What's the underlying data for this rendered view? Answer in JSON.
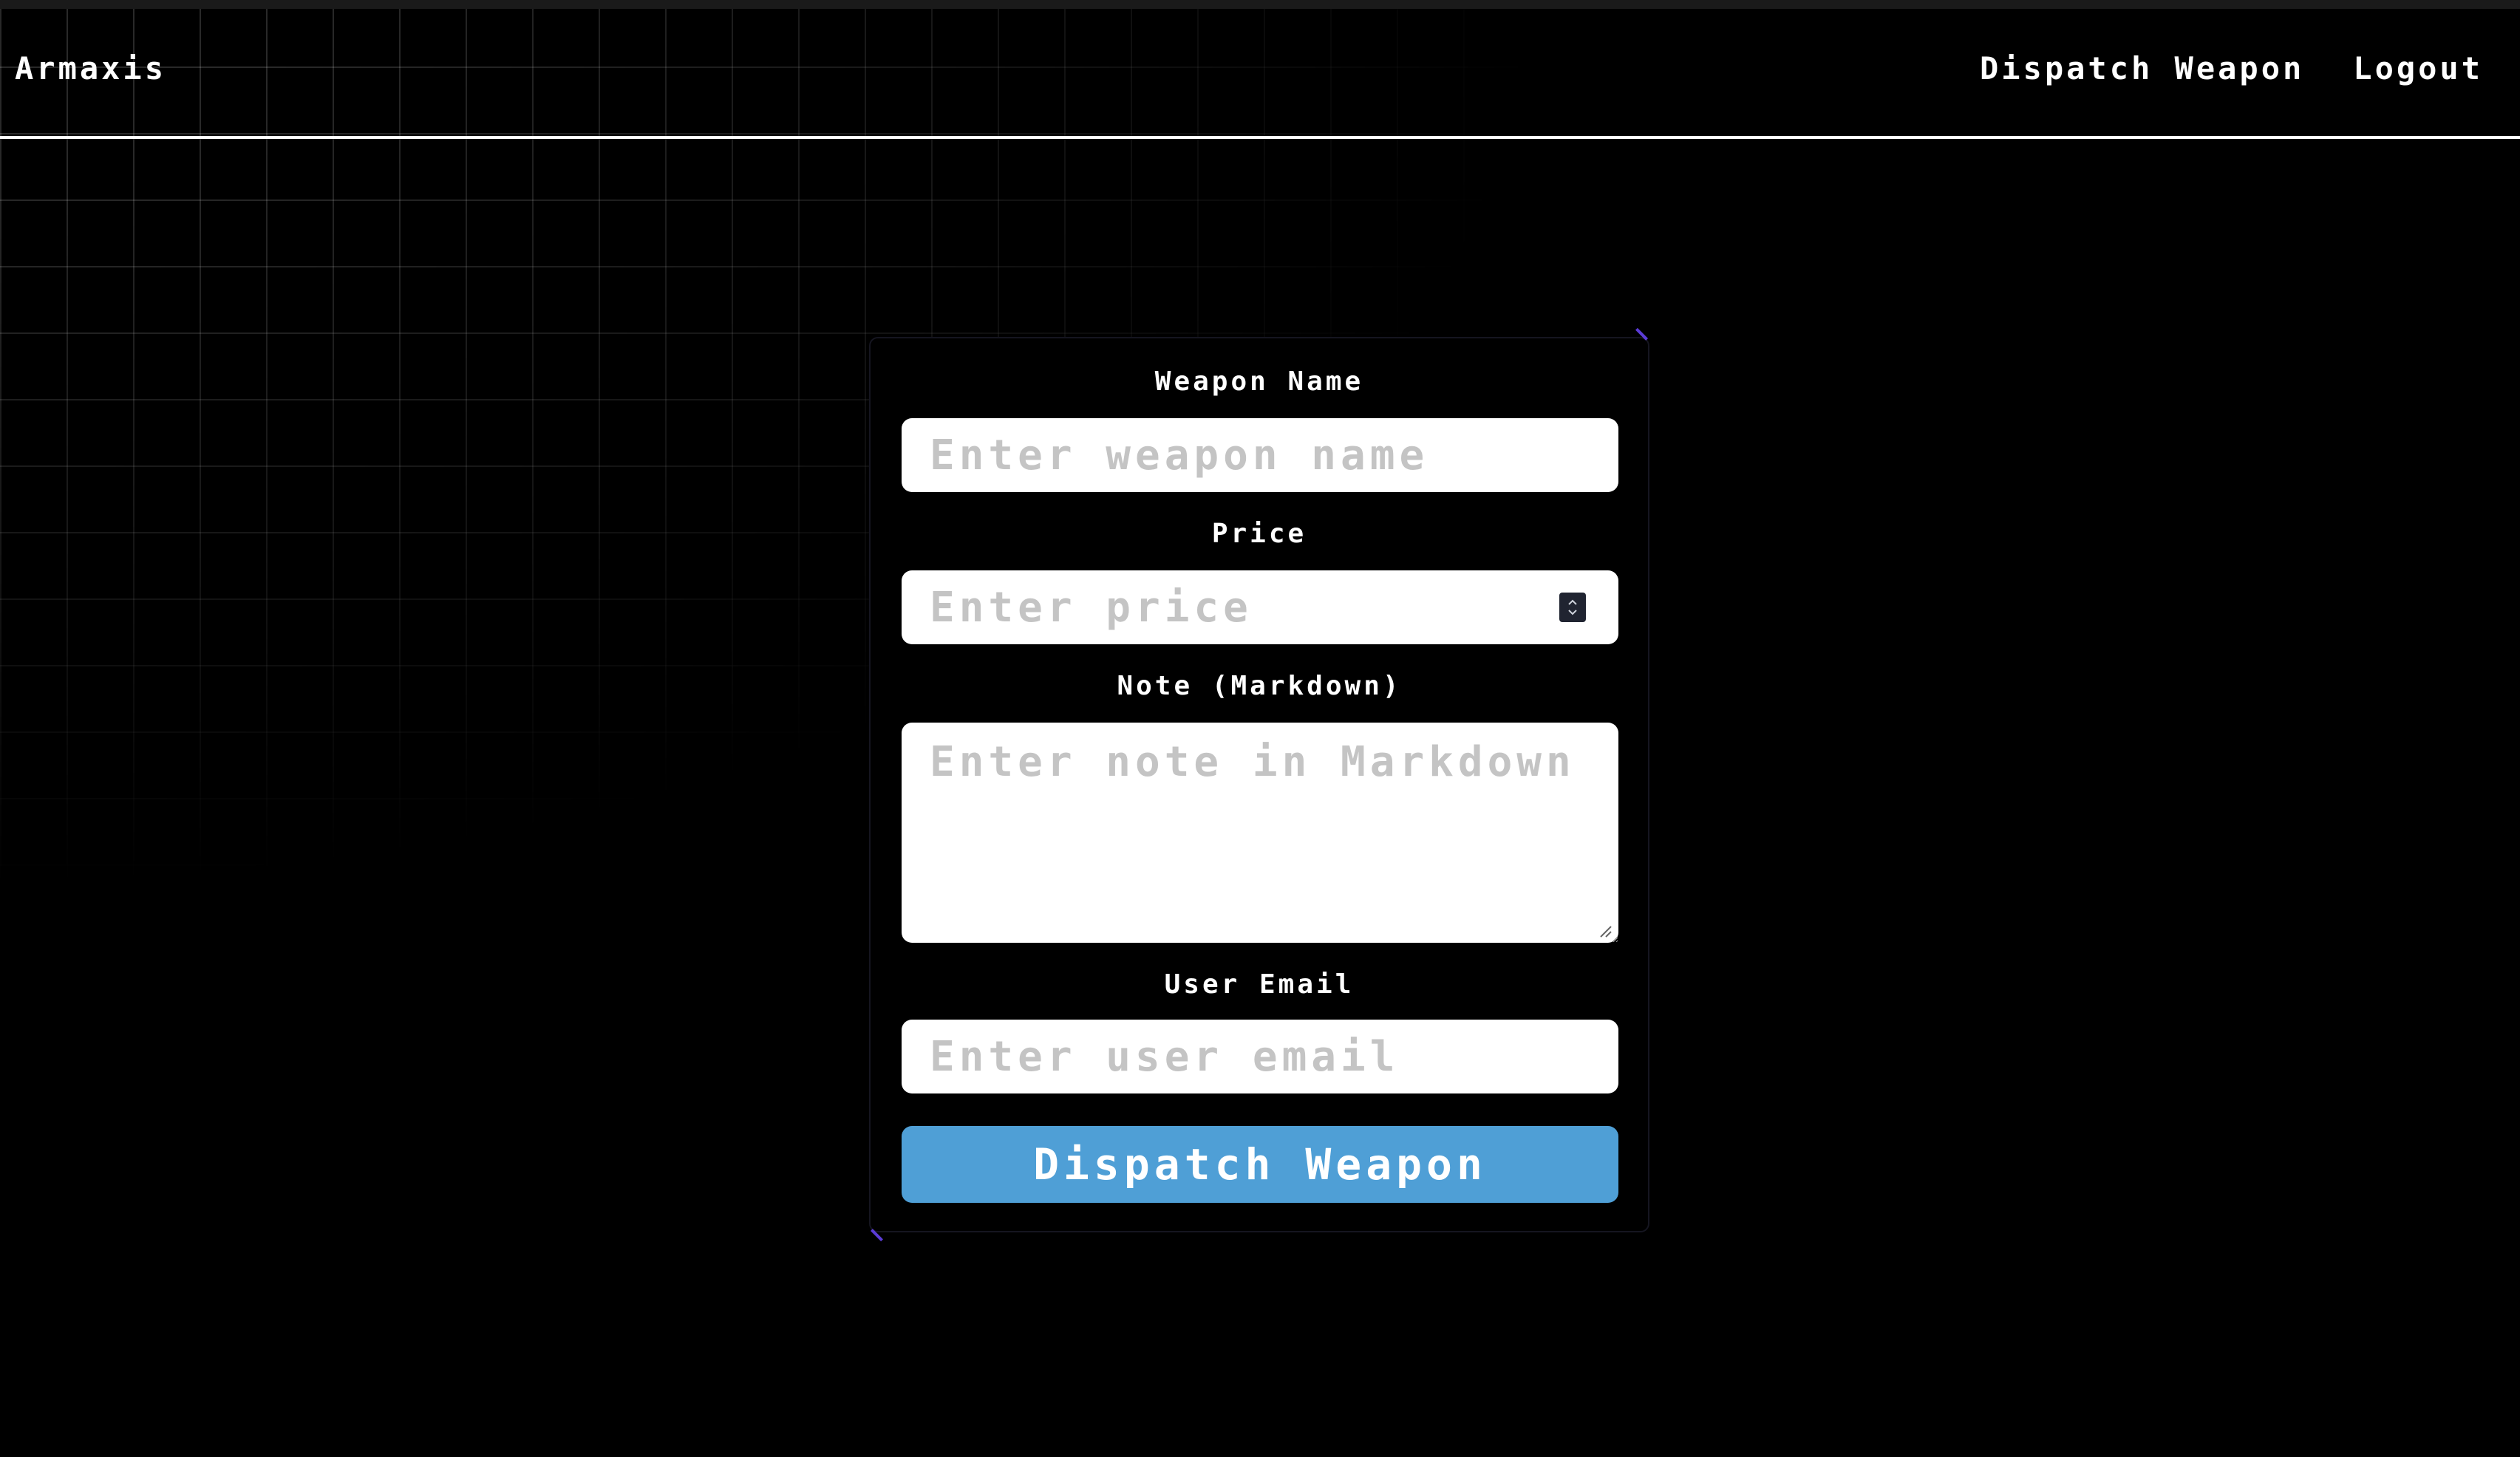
{
  "app": {
    "brand": "Armaxis"
  },
  "nav": {
    "items": [
      {
        "label": "Dispatch Weapon"
      },
      {
        "label": "Logout"
      }
    ]
  },
  "form": {
    "weapon_name": {
      "label": "Weapon Name",
      "placeholder": "Enter weapon name",
      "value": ""
    },
    "price": {
      "label": "Price",
      "placeholder": "Enter price",
      "value": ""
    },
    "note": {
      "label": "Note (Markdown)",
      "placeholder": "Enter note in Markdown",
      "value": ""
    },
    "user_email": {
      "label": "User Email",
      "placeholder": "Enter user email",
      "value": ""
    },
    "submit_label": "Dispatch Weapon"
  },
  "theme": {
    "background": "#000000",
    "button_color": "#4f9fd6",
    "accent_corner": "#5b3cd6",
    "text": "#ffffff"
  },
  "icons": {
    "stepper": "up-down-stepper-icon",
    "resize": "resize-grip-icon"
  }
}
